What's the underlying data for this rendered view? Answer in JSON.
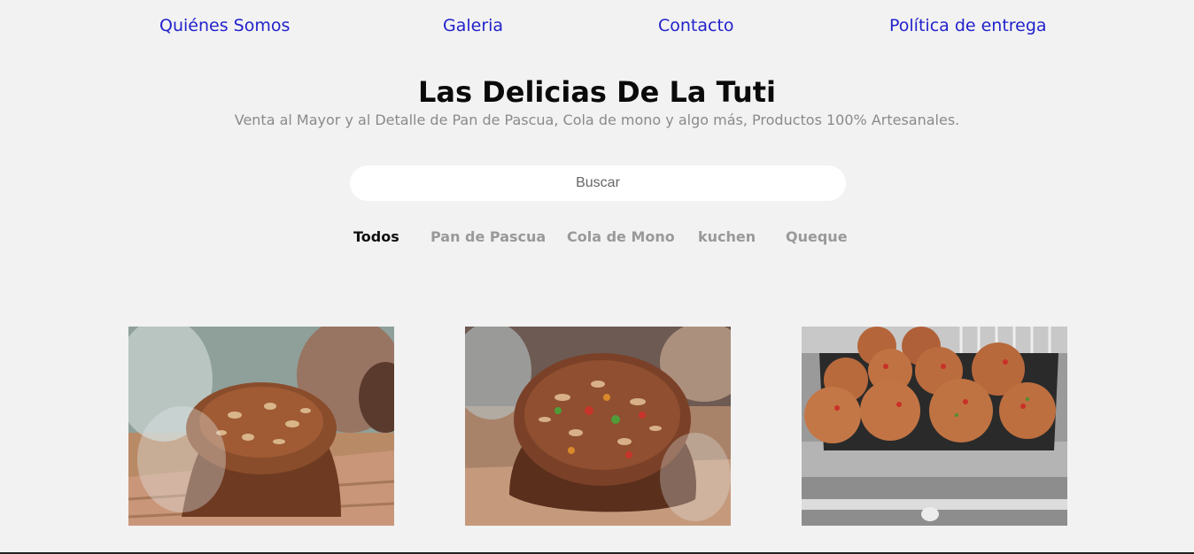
{
  "nav": {
    "items": [
      "Quiénes Somos",
      "Galeria",
      "Contacto",
      "Política de entrega"
    ]
  },
  "header": {
    "title": "Las Delicias De La Tuti",
    "subtitle": "Venta al Mayor y al Detalle de Pan de Pascua, Cola de mono y algo más, Productos 100% Artesanales."
  },
  "search": {
    "placeholder": "Buscar",
    "value": ""
  },
  "filters": {
    "items": [
      "Todos",
      "Pan de Pascua",
      "Cola de Mono",
      "kuchen",
      "Queque"
    ],
    "active": "Todos"
  },
  "gallery": {
    "images": [
      "pan-de-pascua-photo",
      "pan-de-pascua-photo",
      "tray-of-small-breads-photo"
    ]
  },
  "colors": {
    "background": "#f2f2f2",
    "link": "#2222cc",
    "muted": "#999999",
    "title": "#0a0a0a"
  }
}
